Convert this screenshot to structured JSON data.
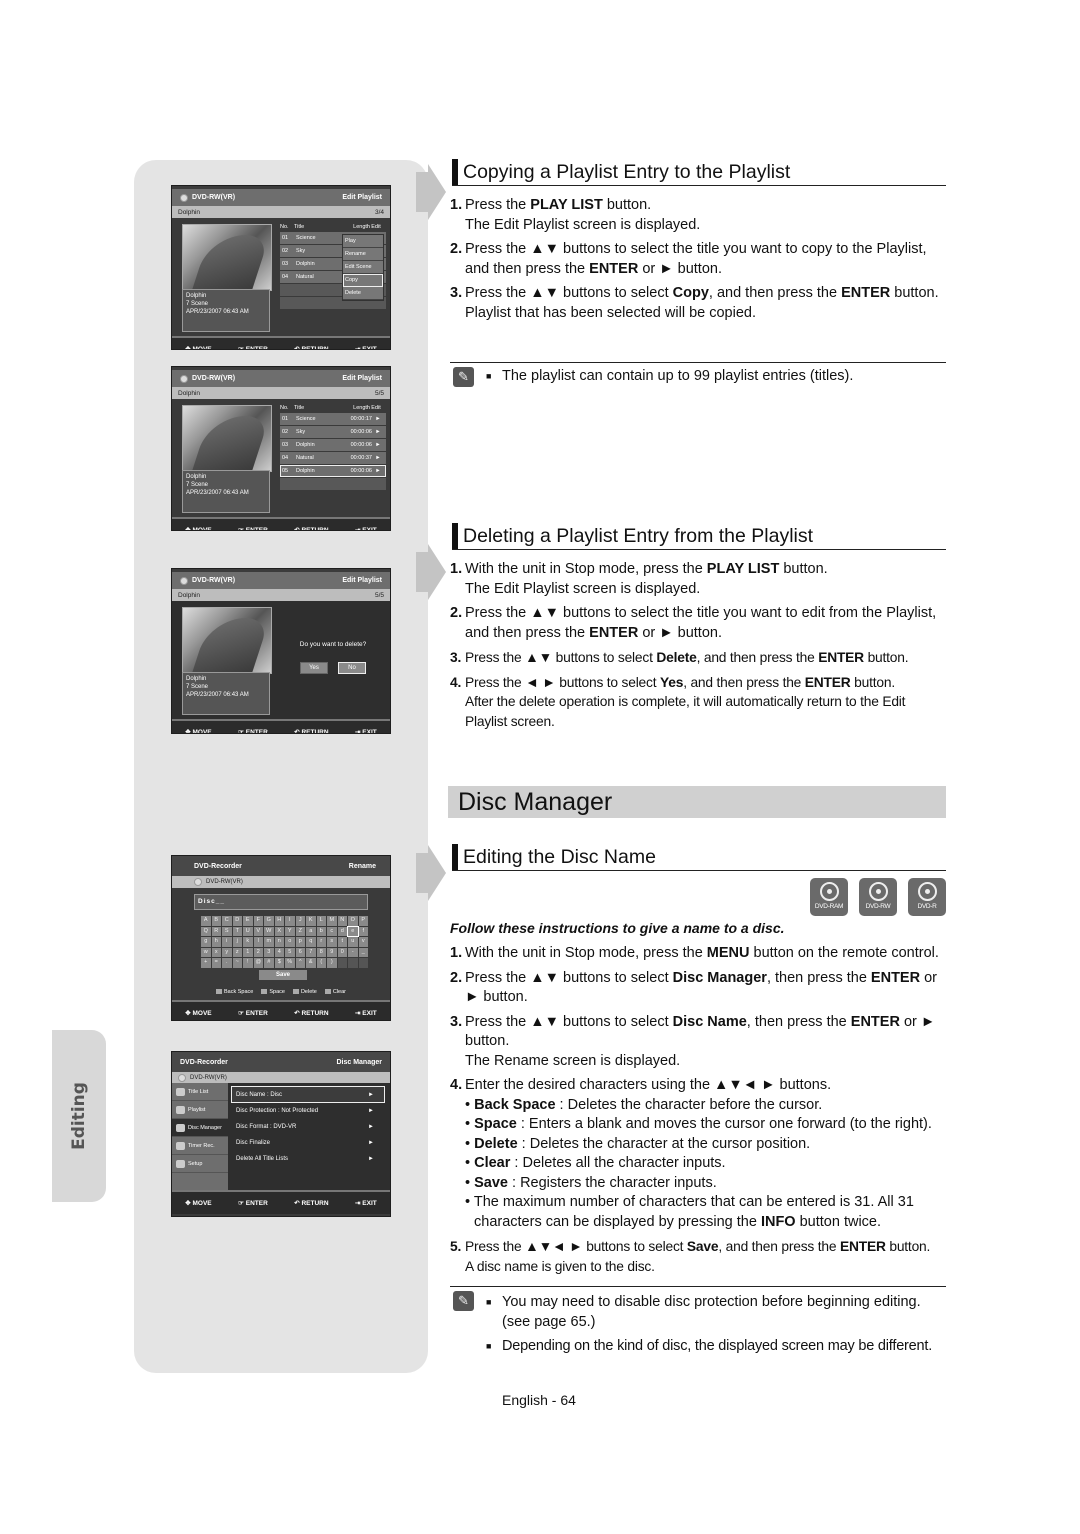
{
  "side_tab": "Editing",
  "screens": {
    "copy": {
      "disc": "DVD-RW(VR)",
      "mode": "Edit Playlist",
      "playlist": "Dolphin",
      "counter": "3/4",
      "info": [
        "Dolphin",
        "7 Scene",
        "APR/23/2007 06:43 AM"
      ],
      "headers": [
        "No.",
        "Title",
        "Length",
        "Edit"
      ],
      "rows": [
        {
          "no": "01",
          "title": "Science"
        },
        {
          "no": "02",
          "title": "Sky"
        },
        {
          "no": "03",
          "title": "Dolphin"
        },
        {
          "no": "04",
          "title": "Natural"
        }
      ],
      "popup": [
        "Play",
        "Rename",
        "Edit Scene",
        "Copy",
        "Delete"
      ],
      "popup_selected": "Copy"
    },
    "copied": {
      "disc": "DVD-RW(VR)",
      "mode": "Edit Playlist",
      "playlist": "Dolphin",
      "counter": "5/5",
      "info": [
        "Dolphin",
        "7 Scene",
        "APR/23/2007 06:43 AM"
      ],
      "headers": [
        "No.",
        "Title",
        "Length",
        "Edit"
      ],
      "rows": [
        {
          "no": "01",
          "title": "Science",
          "length": "00:00:17",
          "edit": "►"
        },
        {
          "no": "02",
          "title": "Sky",
          "length": "00:00:06",
          "edit": "►"
        },
        {
          "no": "03",
          "title": "Dolphin",
          "length": "00:00:06",
          "edit": "►"
        },
        {
          "no": "04",
          "title": "Natural",
          "length": "00:00:37",
          "edit": "►"
        },
        {
          "no": "05",
          "title": "Dolphin",
          "length": "00:00:06",
          "edit": "►"
        }
      ]
    },
    "delete": {
      "disc": "DVD-RW(VR)",
      "mode": "Edit Playlist",
      "playlist": "Dolphin",
      "counter": "5/5",
      "info": [
        "Dolphin",
        "7 Scene",
        "APR/23/2007 06:43 AM"
      ],
      "question": "Do you want to delete?",
      "yes": "Yes",
      "no": "No"
    },
    "rename": {
      "device": "DVD-Recorder",
      "mode": "Rename",
      "disc": "DVD-RW(VR)",
      "input": "Disc__",
      "keys": [
        "A",
        "B",
        "C",
        "D",
        "E",
        "F",
        "G",
        "H",
        "I",
        "J",
        "K",
        "L",
        "M",
        "N",
        "O",
        "P",
        "Q",
        "R",
        "S",
        "T",
        "U",
        "V",
        "W",
        "X",
        "Y",
        "Z",
        "a",
        "b",
        "c",
        "d",
        "e",
        "f",
        "g",
        "h",
        "i",
        "j",
        "k",
        "l",
        "m",
        "n",
        "o",
        "p",
        "q",
        "r",
        "s",
        "t",
        "u",
        "v",
        "w",
        "x",
        "y",
        "z",
        "1",
        "2",
        "3",
        "4",
        "5",
        "6",
        "7",
        "8",
        "9",
        "0",
        "-",
        "_",
        "+",
        "=",
        ".",
        "~",
        "!",
        "@",
        "#",
        "$",
        "%",
        "^",
        "&",
        "(",
        ")",
        "",
        "",
        ""
      ],
      "selected_key": "e",
      "save": "Save",
      "functions": [
        "Back Space",
        "Space",
        "Delete",
        "Clear"
      ]
    },
    "disc_manager": {
      "device": "DVD-Recorder",
      "mode": "Disc Manager",
      "disc": "DVD-RW(VR)",
      "sidebar": [
        "Title List",
        "Playlist",
        "Disc Manager",
        "Timer Rec.",
        "Setup"
      ],
      "sidebar_selected": "Disc Manager",
      "items": [
        "Disc Name : Disc",
        "Disc Protection : Not Protected",
        "Disc Format : DVD-VR",
        "Disc Finalize",
        "Delete All Title Lists"
      ]
    },
    "footer": [
      "MOVE",
      "ENTER",
      "RETURN",
      "EXIT"
    ]
  },
  "copy_section": {
    "title": "Copying a Playlist Entry to the Playlist",
    "steps": [
      {
        "num": "1.",
        "html": "Press the <b>PLAY LIST</b> button.",
        "sub": "The Edit Playlist screen is displayed."
      },
      {
        "num": "2.",
        "html": "Press the ▲▼ buttons to select the title you want to copy to the Playlist, and then press the <b>ENTER</b> or ► button."
      },
      {
        "num": "3.",
        "html": "Press the ▲▼ buttons to select <b>Copy</b>, and then press the <b>ENTER</b> button.",
        "sub": "Playlist that has been selected will be copied."
      }
    ],
    "note": "The playlist can contain up to 99 playlist entries (titles)."
  },
  "delete_section": {
    "title": "Deleting a Playlist Entry from the Playlist",
    "steps": [
      {
        "num": "1.",
        "html": "With the unit in Stop mode, press the <b>PLAY LIST</b> button.",
        "sub": "The Edit Playlist screen is displayed."
      },
      {
        "num": "2.",
        "html": "Press the ▲▼ buttons to select the title you want to edit from the Playlist, and then press the <b>ENTER</b> or ► button."
      },
      {
        "num": "3.",
        "html": "Press the ▲▼ buttons to select <b>Delete</b>, and then press the <b>ENTER</b> button."
      },
      {
        "num": "4.",
        "html": "Press the ◄ ► buttons to select <b>Yes</b>, and then press the <b>ENTER</b> button.",
        "sub": "After the delete operation is complete, it will automatically return to the Edit Playlist screen."
      }
    ]
  },
  "disc_manager_banner": "Disc Manager",
  "disc_name_section": {
    "title": "Editing the Disc Name",
    "badges": [
      "DVD-RAM",
      "DVD-RW",
      "DVD-R"
    ],
    "intro": "Follow these instructions to give a name to a disc.",
    "steps": [
      {
        "num": "1.",
        "html": "With the unit in Stop mode, press the <b>MENU</b> button on the remote control."
      },
      {
        "num": "2.",
        "html": "Press the ▲▼ buttons to select <b>Disc Manager</b>, then press the <b>ENTER</b> or ► button."
      },
      {
        "num": "3.",
        "html": "Press the ▲▼ buttons to select <b>Disc Name</b>, then press the <b>ENTER</b> or ► button.",
        "sub": "The Rename screen is displayed."
      },
      {
        "num": "4.",
        "html": "Enter the desired characters using the ▲▼◄ ► buttons."
      }
    ],
    "bullets": [
      {
        "term": "Back Space",
        "desc": " : Deletes the character before the cursor."
      },
      {
        "term": "Space",
        "desc": " : Enters a blank and moves the cursor one forward (to the right)."
      },
      {
        "term": "Delete",
        "desc": " : Deletes the character at the cursor position."
      },
      {
        "term": "Clear",
        "desc": " : Deletes all the character inputs."
      },
      {
        "term": "Save",
        "desc": " : Registers the character inputs."
      }
    ],
    "max_chars_note": "The maximum number of characters that can be entered is 31. All 31 characters can be displayed by pressing the <b>INFO</b> button twice.",
    "step5": {
      "num": "5.",
      "html": "Press the ▲▼◄ ► buttons to select <b>Save</b>, and then press the <b>ENTER</b> button.",
      "sub": "A disc name is given to the disc."
    },
    "notes": [
      "You may need to disable disc protection before beginning editing. (see page 65.)",
      "Depending on the kind of disc, the displayed screen may be different."
    ]
  },
  "page_number": "English - 64"
}
